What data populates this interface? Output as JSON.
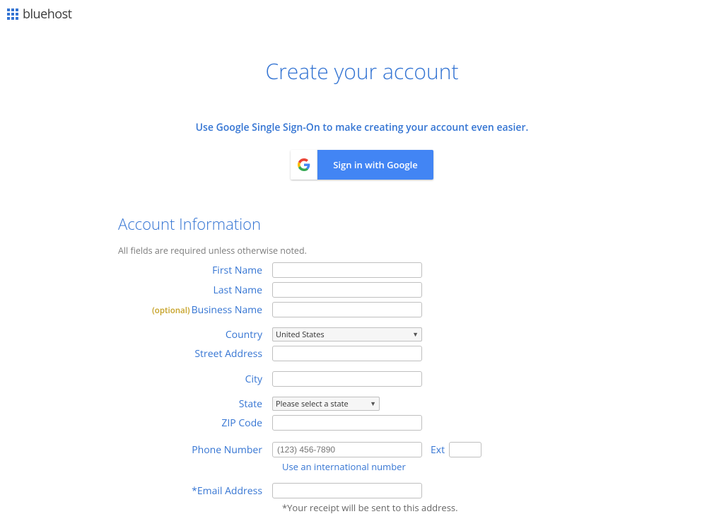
{
  "brand": {
    "name": "bluehost"
  },
  "title": "Create your account",
  "sso_prompt": "Use Google Single Sign-On to make creating your account even easier.",
  "google_btn": "Sign in with Google",
  "section_title": "Account Information",
  "required_note": "All fields are required unless otherwise noted.",
  "labels": {
    "first_name": "First Name",
    "last_name": "Last Name",
    "business_name": "Business Name",
    "optional": "(optional)",
    "country": "Country",
    "street_address": "Street Address",
    "city": "City",
    "state": "State",
    "zip": "ZIP Code",
    "phone": "Phone Number",
    "ext": "Ext",
    "email": "*Email Address"
  },
  "values": {
    "country": "United States",
    "state": "Please select a state",
    "phone_placeholder": "(123) 456-7890"
  },
  "intl_note": "Use an international number",
  "email_note": "*Your receipt will be sent to this address."
}
